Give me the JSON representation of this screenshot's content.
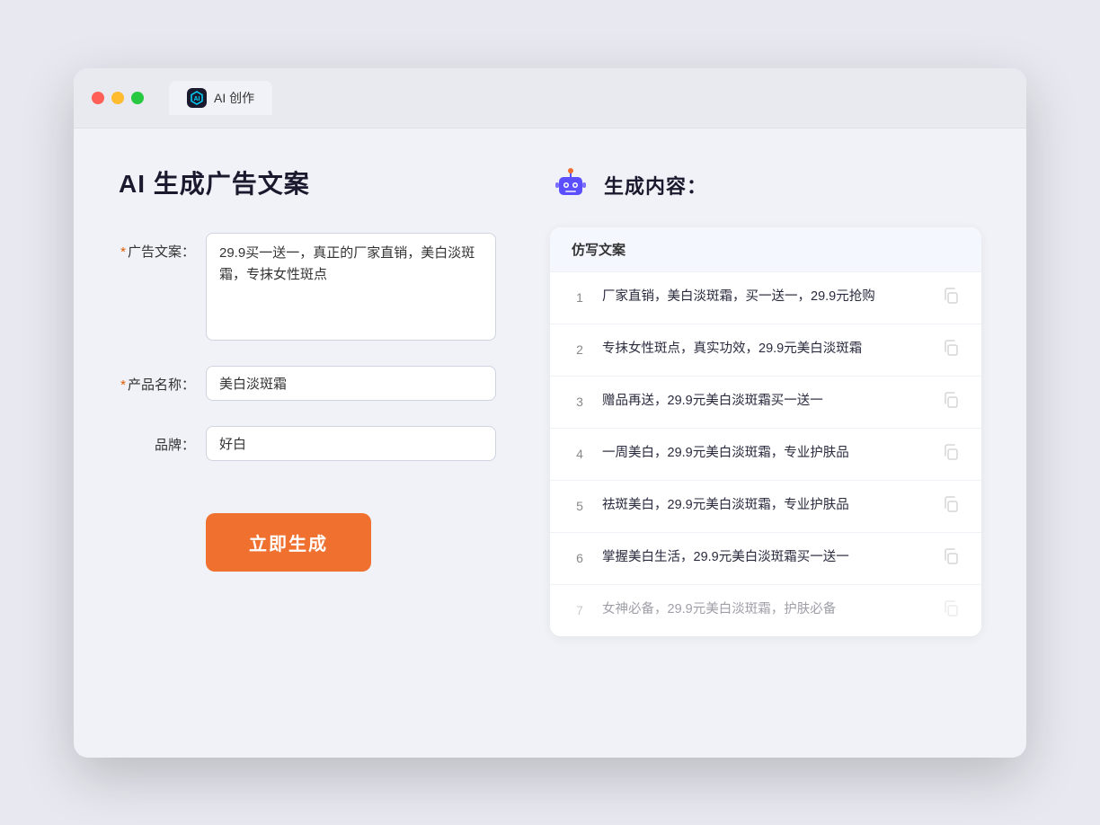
{
  "window": {
    "tab_label": "AI 创作",
    "tab_icon_text": "AI"
  },
  "left_panel": {
    "title": "AI 生成广告文案",
    "form": {
      "ad_copy_label": "广告文案：",
      "ad_copy_required": true,
      "ad_copy_value": "29.9买一送一，真正的厂家直销，美白淡斑霜，专抹女性斑点",
      "product_name_label": "产品名称：",
      "product_name_required": true,
      "product_name_value": "美白淡斑霜",
      "brand_label": "品牌：",
      "brand_required": false,
      "brand_value": "好白"
    },
    "generate_button": "立即生成"
  },
  "right_panel": {
    "title": "生成内容：",
    "results_header": "仿写文案",
    "results": [
      {
        "num": 1,
        "text": "厂家直销，美白淡斑霜，买一送一，29.9元抢购",
        "faded": false
      },
      {
        "num": 2,
        "text": "专抹女性斑点，真实功效，29.9元美白淡斑霜",
        "faded": false
      },
      {
        "num": 3,
        "text": "赠品再送，29.9元美白淡斑霜买一送一",
        "faded": false
      },
      {
        "num": 4,
        "text": "一周美白，29.9元美白淡斑霜，专业护肤品",
        "faded": false
      },
      {
        "num": 5,
        "text": "祛斑美白，29.9元美白淡斑霜，专业护肤品",
        "faded": false
      },
      {
        "num": 6,
        "text": "掌握美白生活，29.9元美白淡斑霜买一送一",
        "faded": false
      },
      {
        "num": 7,
        "text": "女神必备，29.9元美白淡斑霜，护肤必备",
        "faded": true
      }
    ]
  }
}
